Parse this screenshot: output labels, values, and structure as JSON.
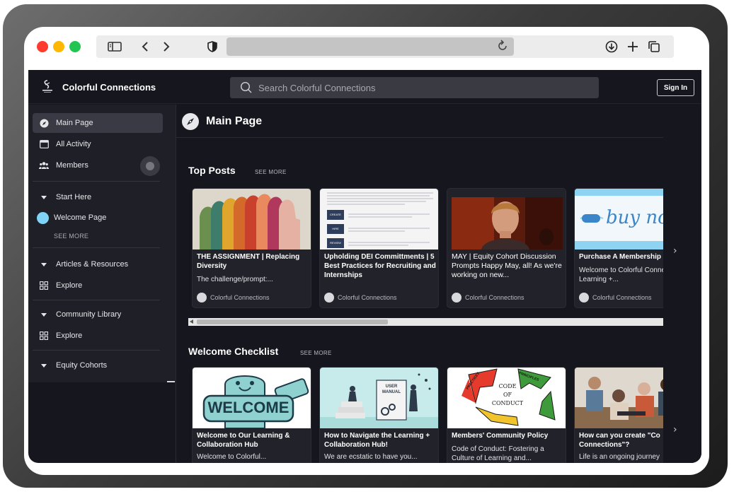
{
  "browser": {
    "toolbar_icons": [
      "sidebar-icon",
      "back-icon",
      "forward-icon",
      "shield-icon",
      "reload-icon",
      "download-icon",
      "plus-icon",
      "tabs-icon"
    ]
  },
  "header": {
    "brand": "Colorful Connections",
    "search_placeholder": "Search Colorful Connections",
    "signin_label": "Sign In"
  },
  "sidebar": {
    "main_page": "Main Page",
    "all_activity": "All Activity",
    "members": "Members",
    "start_here": "Start Here",
    "welcome_page": "Welcome Page",
    "see_more": "SEE MORE",
    "articles_resources": "Articles & Resources",
    "explore_1": "Explore",
    "community_library": "Community Library",
    "explore_2": "Explore",
    "equity_cohorts": "Equity Cohorts"
  },
  "main": {
    "title": "Main Page",
    "top_posts": {
      "title": "Top Posts",
      "see_more": "SEE MORE",
      "cards": [
        {
          "title": "THE ASSIGNMENT | Replacing Diversity",
          "excerpt": "The challenge/prompt:...",
          "author": "Colorful Connections"
        },
        {
          "title": "Upholding DEI Committments | 5 Best Practices for Recruiting and Internships",
          "excerpt": "",
          "author": "Colorful Connections",
          "thumb_rows": [
            "CREATE",
            "HIRE",
            "REVIEW"
          ]
        },
        {
          "title": "MAY | Equity Cohort Discussion Prompts Happy May, all! As we're working on new...",
          "excerpt": "",
          "author": "Colorful Connections"
        },
        {
          "title": "Purchase A Membership",
          "excerpt": "Welcome to Colorful Connections' Learning +...",
          "author": "Colorful Connections",
          "thumb_text": "buy now"
        }
      ]
    },
    "checklist": {
      "title": "Welcome Checklist",
      "see_more": "SEE MORE",
      "cards": [
        {
          "title": "Welcome to Our Learning & Collaboration Hub",
          "excerpt": "Welcome to Colorful...",
          "thumb_text": "WELCOME"
        },
        {
          "title": "How to Navigate the Learning + Collaboration Hub!",
          "excerpt": "We are ecstatic to have you...",
          "thumb_text_1": "USER",
          "thumb_text_2": "MANUAL"
        },
        {
          "title": "Members' Community Policy",
          "excerpt": "Code of Conduct: Fostering a Culture of Learning and...",
          "thumb_text_1": "CODE",
          "thumb_text_2": "OF",
          "thumb_text_3": "CONDUCT",
          "thumb_text_4": "PRACTICES",
          "thumb_text_5": "PRINCIPLES"
        },
        {
          "title": "How can you create \"Co Connections\"?",
          "excerpt": "Life is an ongoing journey"
        }
      ]
    }
  },
  "colors": {
    "app_bg": "#16161e",
    "sidebar_bg": "#1f1f27",
    "search_bg": "#3a3a42",
    "accent_blue": "#7fd3f7"
  }
}
